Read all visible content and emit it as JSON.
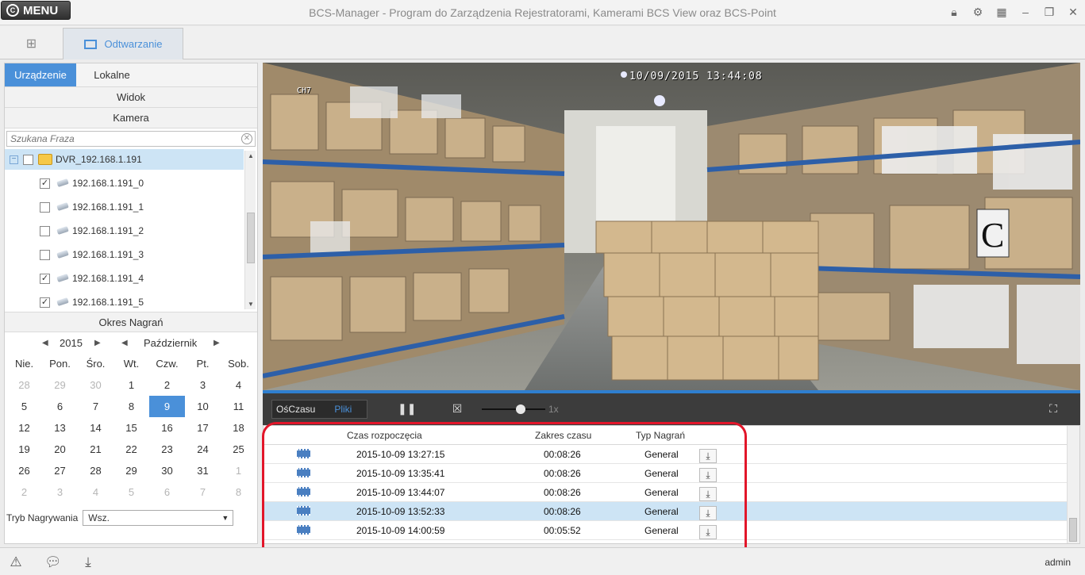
{
  "app": {
    "menu_label": "MENU",
    "title": "BCS-Manager - Program do Zarządzenia Rejestratorami, Kamerami BCS View oraz BCS-Point"
  },
  "tabs": {
    "active_label": "Odtwarzanie"
  },
  "left": {
    "source_tabs": [
      "Urządzenie",
      "Lokalne"
    ],
    "view_label": "Widok",
    "camera_label": "Kamera",
    "search_placeholder": "Szukana Fraza",
    "tree": {
      "root": "DVR_192.168.1.191",
      "channels": [
        {
          "name": "192.168.1.191_0",
          "checked": true
        },
        {
          "name": "192.168.1.191_1",
          "checked": false
        },
        {
          "name": "192.168.1.191_2",
          "checked": false
        },
        {
          "name": "192.168.1.191_3",
          "checked": false
        },
        {
          "name": "192.168.1.191_4",
          "checked": true
        },
        {
          "name": "192.168.1.191_5",
          "checked": true
        }
      ]
    },
    "period_label": "Okres Nagrań",
    "calendar": {
      "year": "2015",
      "month": "Październik",
      "weekdays": [
        "Nie.",
        "Pon.",
        "Śro.",
        "Wt.",
        "Czw.",
        "Pt.",
        "Sob."
      ],
      "weeks": [
        [
          "28",
          "29",
          "30",
          "1",
          "2",
          "3",
          "4"
        ],
        [
          "5",
          "6",
          "7",
          "8",
          "9",
          "10",
          "11"
        ],
        [
          "12",
          "13",
          "14",
          "15",
          "16",
          "17",
          "18"
        ],
        [
          "19",
          "20",
          "21",
          "22",
          "23",
          "24",
          "25"
        ],
        [
          "26",
          "27",
          "28",
          "29",
          "30",
          "31",
          "1"
        ],
        [
          "2",
          "3",
          "4",
          "5",
          "6",
          "7",
          "8"
        ]
      ],
      "selected": "9"
    },
    "record_mode_label": "Tryb Nagrywania",
    "record_mode_value": "Wsz."
  },
  "video": {
    "timestamp": "10/09/2015 13:44:08",
    "channel": "CH7"
  },
  "controls": {
    "mode_tabs": [
      "OśCzasu",
      "Pliki"
    ],
    "speed": "1x"
  },
  "files": {
    "headers": [
      "Czas rozpoczęcia",
      "Zakres czasu",
      "Typ Nagrań"
    ],
    "rows": [
      {
        "start": "2015-10-09 13:27:15",
        "duration": "00:08:26",
        "type": "General"
      },
      {
        "start": "2015-10-09 13:35:41",
        "duration": "00:08:26",
        "type": "General"
      },
      {
        "start": "2015-10-09 13:44:07",
        "duration": "00:08:26",
        "type": "General"
      },
      {
        "start": "2015-10-09 13:52:33",
        "duration": "00:08:26",
        "type": "General"
      },
      {
        "start": "2015-10-09 14:00:59",
        "duration": "00:05:52",
        "type": "General"
      }
    ],
    "selected_index": 3
  },
  "status": {
    "user": "admin"
  },
  "colors": {
    "accent": "#4a90d9",
    "highlight": "#e2162a"
  }
}
